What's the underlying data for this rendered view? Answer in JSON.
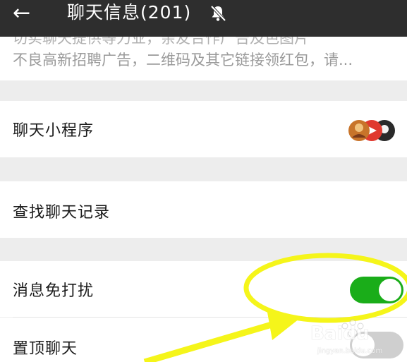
{
  "header": {
    "back_icon": "arrow-left-icon",
    "title": "聊天信息(201)",
    "mute_icon": "bell-off-icon"
  },
  "notice": {
    "line1": "切实聊天提供等力业，亲友合作广告及色图片",
    "line2": "不良高新招聘广告，二维码及其它链接领红包，请..."
  },
  "rows": {
    "mini_programs": {
      "label": "聊天小程序",
      "icon": "mini-program-avatars"
    },
    "search_history": {
      "label": "查找聊天记录"
    },
    "do_not_disturb": {
      "label": "消息免打扰",
      "on": true
    },
    "sticky_on_top": {
      "label": "置顶聊天",
      "on": false
    }
  },
  "colors": {
    "header_bg": "#2e2e2e",
    "toggle_on": "#1aad19",
    "toggle_off": "#cfcfcf",
    "annotation": "#f5f51a"
  },
  "watermark": {
    "brand": "Baidu",
    "sub": "jingyan.baidu.com"
  }
}
